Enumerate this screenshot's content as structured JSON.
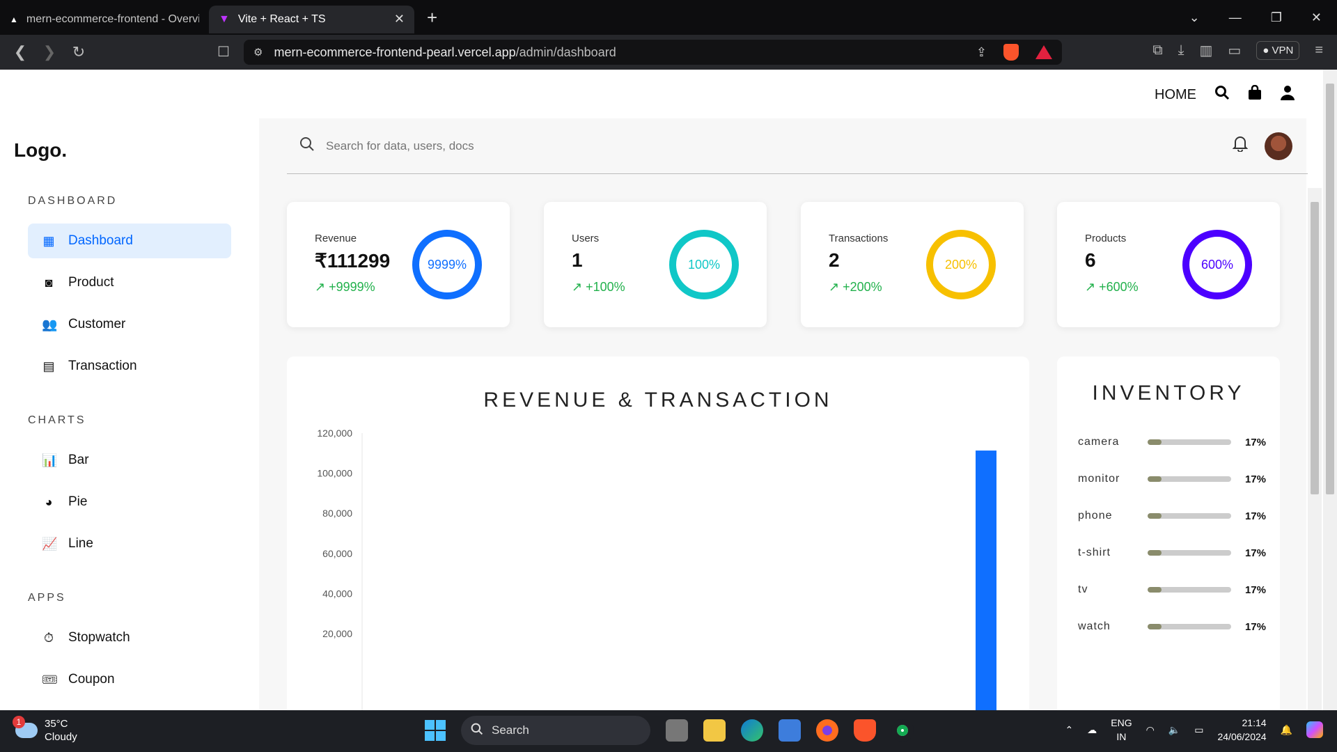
{
  "browser": {
    "tabs": [
      {
        "title": "mern-ecommerce-frontend - Overvie",
        "active": false
      },
      {
        "title": "Vite + React + TS",
        "active": true
      }
    ],
    "url_host": "mern-ecommerce-frontend-pearl.vercel.app",
    "url_path": "/admin/dashboard",
    "vpn_label": "VPN"
  },
  "topnav": {
    "home": "HOME"
  },
  "sidebar": {
    "logo": "Logo.",
    "sections": [
      {
        "title": "DASHBOARD",
        "items": [
          {
            "label": "Dashboard",
            "icon": "grid-icon",
            "active": true
          },
          {
            "label": "Product",
            "icon": "bag-icon"
          },
          {
            "label": "Customer",
            "icon": "people-icon"
          },
          {
            "label": "Transaction",
            "icon": "document-icon"
          }
        ]
      },
      {
        "title": "CHARTS",
        "items": [
          {
            "label": "Bar",
            "icon": "bar-chart-icon"
          },
          {
            "label": "Pie",
            "icon": "pie-chart-icon"
          },
          {
            "label": "Line",
            "icon": "line-chart-icon"
          }
        ]
      },
      {
        "title": "APPS",
        "items": [
          {
            "label": "Stopwatch",
            "icon": "stopwatch-icon"
          },
          {
            "label": "Coupon",
            "icon": "ticket-icon"
          }
        ]
      }
    ]
  },
  "search": {
    "placeholder": "Search for data, users, docs"
  },
  "widgets": [
    {
      "label": "Revenue",
      "value": "₹111299",
      "change": "+9999%",
      "percent": "9999%",
      "color": "#0f6fff"
    },
    {
      "label": "Users",
      "value": "1",
      "change": "+100%",
      "percent": "100%",
      "color": "#10c7c7"
    },
    {
      "label": "Transactions",
      "value": "2",
      "change": "+200%",
      "percent": "200%",
      "color": "#f7c000"
    },
    {
      "label": "Products",
      "value": "6",
      "change": "+600%",
      "percent": "600%",
      "color": "#4c00ff"
    }
  ],
  "chart_title": "REVENUE & TRANSACTION",
  "chart_data": {
    "type": "bar",
    "title": "REVENUE & TRANSACTION",
    "ylabel": "",
    "xlabel": "",
    "ylim": [
      0,
      120000
    ],
    "yticks": [
      20000,
      40000,
      60000,
      80000,
      100000,
      120000
    ],
    "ytick_labels": [
      "20,000",
      "40,000",
      "60,000",
      "80,000",
      "100,000",
      "120,000"
    ],
    "series": [
      {
        "color": "#0f6fff",
        "values": [
          0,
          0,
          0,
          0,
          0,
          111299
        ]
      }
    ]
  },
  "inventory": {
    "title": "INVENTORY",
    "items": [
      {
        "name": "camera",
        "value": 17,
        "label": "17%"
      },
      {
        "name": "monitor",
        "value": 17,
        "label": "17%"
      },
      {
        "name": "phone",
        "value": 17,
        "label": "17%"
      },
      {
        "name": "t-shirt",
        "value": 17,
        "label": "17%"
      },
      {
        "name": "tv",
        "value": 17,
        "label": "17%"
      },
      {
        "name": "watch",
        "value": 17,
        "label": "17%"
      }
    ]
  },
  "taskbar": {
    "temperature": "35°C",
    "weather": "Cloudy",
    "weather_badge": "1",
    "search_label": "Search",
    "lang_1": "ENG",
    "lang_2": "IN",
    "time": "21:14",
    "date": "24/06/2024"
  }
}
